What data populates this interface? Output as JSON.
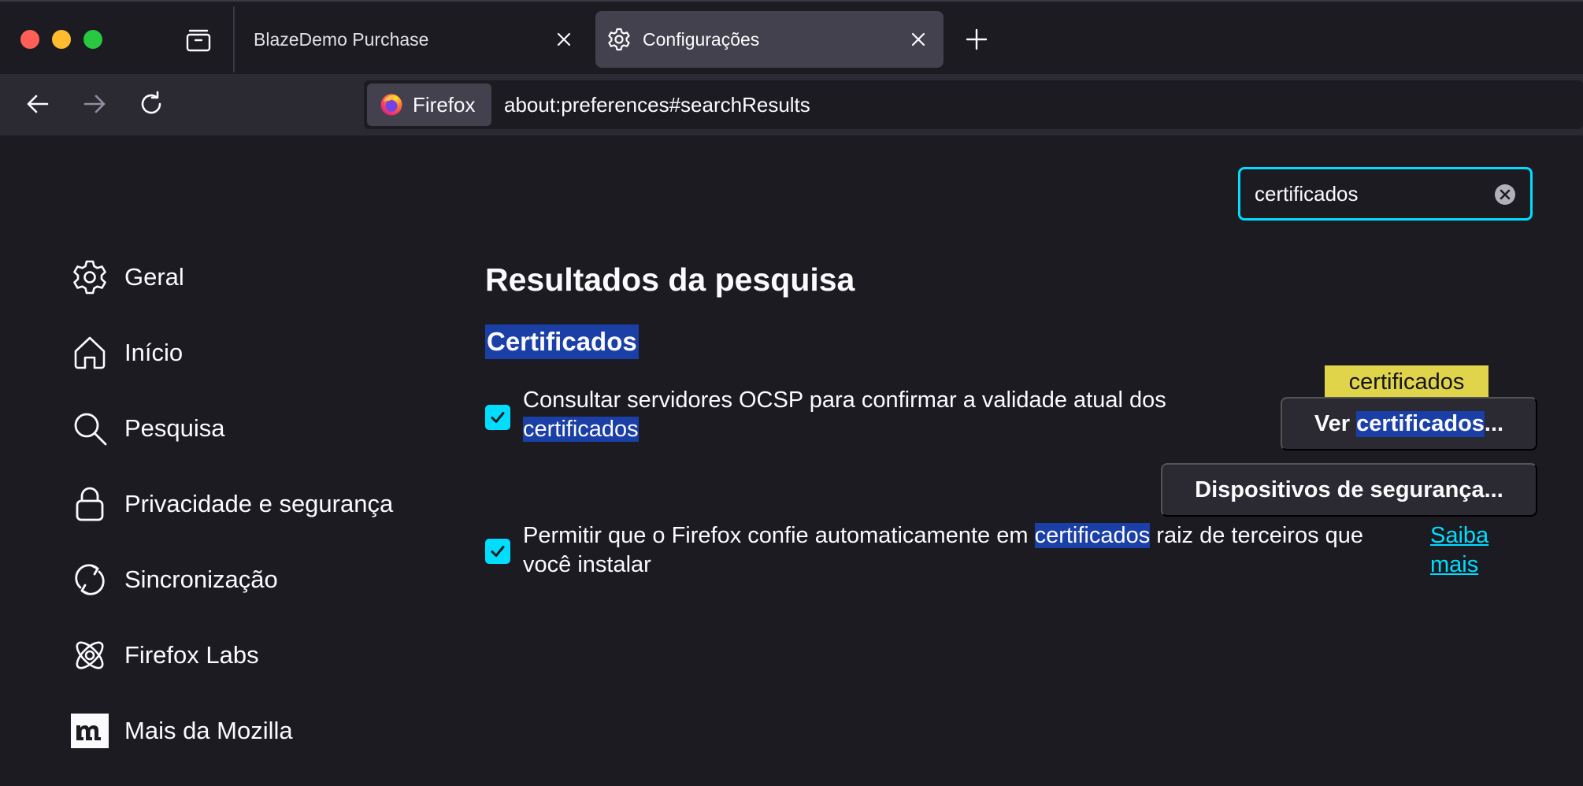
{
  "tabs": [
    {
      "title": "BlazeDemo Purchase",
      "active": false
    },
    {
      "title": "Configurações",
      "active": true,
      "icon": "gear-icon"
    }
  ],
  "navbar": {
    "identity_label": "Firefox",
    "url": "about:preferences#searchResults"
  },
  "search": {
    "value": "certificados"
  },
  "sidebar": {
    "items": [
      {
        "label": "Geral",
        "icon": "gear-icon"
      },
      {
        "label": "Início",
        "icon": "home-icon"
      },
      {
        "label": "Pesquisa",
        "icon": "search-icon"
      },
      {
        "label": "Privacidade e segurança",
        "icon": "lock-icon"
      },
      {
        "label": "Sincronização",
        "icon": "sync-icon"
      },
      {
        "label": "Firefox Labs",
        "icon": "atom-icon"
      },
      {
        "label": "Mais da Mozilla",
        "icon": "mozilla-m-icon"
      }
    ]
  },
  "main": {
    "heading": "Resultados da pesquisa",
    "group_title": "Certificados",
    "ocsp": {
      "checked": true,
      "text_before": "Consultar servidores OCSP para confirmar a validade atual dos ",
      "highlight": "certificados"
    },
    "view_certs": {
      "prefix": "Ver ",
      "highlight": "certificados",
      "suffix": "..."
    },
    "tooltip": "certificados",
    "security_devices": "Dispositivos de segurança...",
    "roots": {
      "checked": true,
      "text_before": "Permitir que o Firefox confie automaticamente em ",
      "highlight": "certificados",
      "text_after": " raiz de terceiros que você instalar"
    },
    "learn_more": "Saiba mais"
  },
  "colors": {
    "accent": "#00ddff",
    "highlight": "#1a3fa6",
    "tooltip": "#e0d54a",
    "background": "#1c1b22"
  }
}
